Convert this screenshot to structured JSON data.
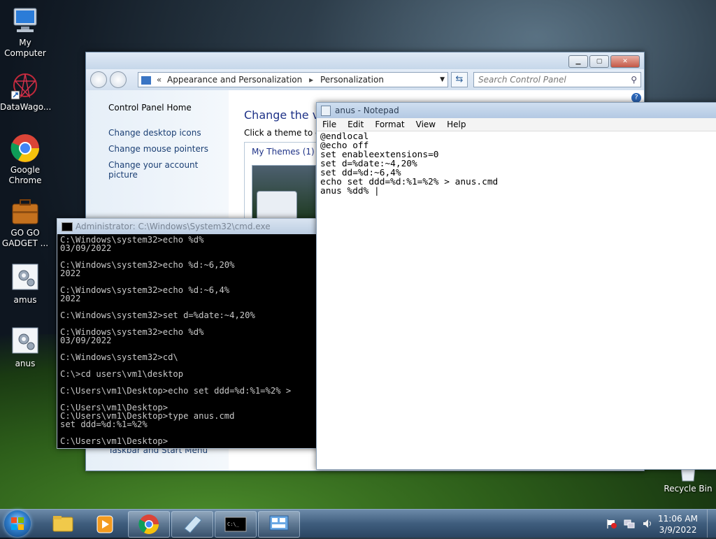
{
  "desktop": {
    "icons": [
      {
        "label": "My Computer"
      },
      {
        "label": "DataWago..."
      },
      {
        "label": "Google Chrome"
      },
      {
        "label": "GO GO GADGET ..."
      },
      {
        "label": "amus"
      },
      {
        "label": "anus"
      },
      {
        "label": "Recycle Bin"
      }
    ]
  },
  "control_panel": {
    "breadcrumb": [
      "Appearance and Personalization",
      "Personalization"
    ],
    "search_placeholder": "Search Control Panel",
    "left_links": [
      "Control Panel Home",
      "Change desktop icons",
      "Change mouse pointers",
      "Change your account picture"
    ],
    "bottom_link": "Taskbar and Start Menu",
    "main_title": "Change the vis",
    "main_subtitle": "Click a theme to ch",
    "my_themes": "My Themes (1)"
  },
  "cmd": {
    "title": "Administrator: C:\\Windows\\System32\\cmd.exe",
    "lines": "C:\\Windows\\system32>echo %d%\n03/09/2022\n\nC:\\Windows\\system32>echo %d:~6,20%\n2022\n\nC:\\Windows\\system32>echo %d:~6,4%\n2022\n\nC:\\Windows\\system32>set d=%date:~4,20%\n\nC:\\Windows\\system32>echo %d%\n03/09/2022\n\nC:\\Windows\\system32>cd\\\n\nC:\\>cd users\\vm1\\desktop\n\nC:\\Users\\vm1\\Desktop>echo set ddd=%d:%1=%2% >\n\nC:\\Users\\vm1\\Desktop>\nC:\\Users\\vm1\\Desktop>type anus.cmd\nset ddd=%d:%1=%2%\n\nC:\\Users\\vm1\\Desktop>"
  },
  "notepad": {
    "title": "anus - Notepad",
    "menu": [
      "File",
      "Edit",
      "Format",
      "View",
      "Help"
    ],
    "content": "@endlocal\n@echo off\nset enableextensions=0\nset d=%date:~4,20%\nset dd=%d:~6,4%\necho set ddd=%d:%1=%2% > anus.cmd\nanus %dd% |"
  },
  "taskbar": {
    "time": "11:06 AM",
    "date": "3/9/2022"
  }
}
